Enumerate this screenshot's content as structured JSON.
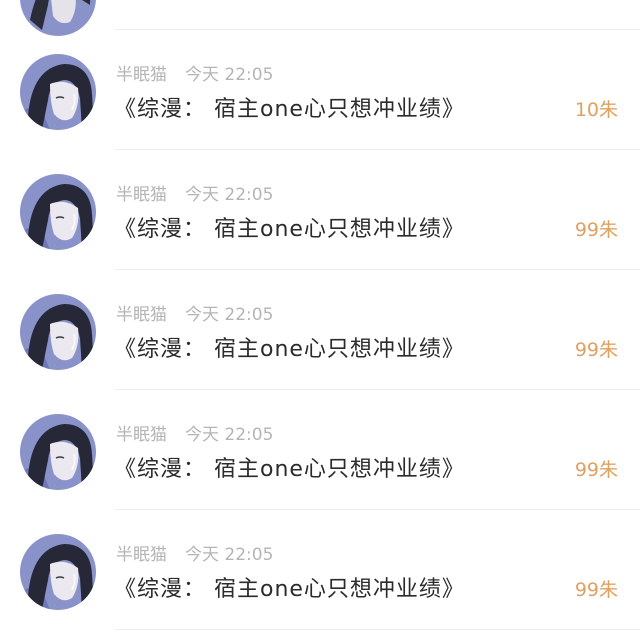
{
  "list": {
    "items": [
      {
        "user": "半眠猫",
        "time": "今天 22:05",
        "title": "《综漫： 宿主one心只想冲业绩》",
        "amount": "10朱"
      },
      {
        "user": "半眠猫",
        "time": "今天 22:05",
        "title": "《综漫： 宿主one心只想冲业绩》",
        "amount": "99朱"
      },
      {
        "user": "半眠猫",
        "time": "今天 22:05",
        "title": "《综漫： 宿主one心只想冲业绩》",
        "amount": "99朱"
      },
      {
        "user": "半眠猫",
        "time": "今天 22:05",
        "title": "《综漫： 宿主one心只想冲业绩》",
        "amount": "99朱"
      },
      {
        "user": "半眠猫",
        "time": "今天 22:05",
        "title": "《综漫： 宿主one心只想冲业绩》",
        "amount": "99朱"
      }
    ]
  },
  "colors": {
    "amount": "#e0a15e",
    "meta": "#b5b5b5",
    "title": "#2b2b2b",
    "avatar_bg": "#8a93c9"
  },
  "icons": {
    "avatar": "avatar-illustration-icon"
  }
}
